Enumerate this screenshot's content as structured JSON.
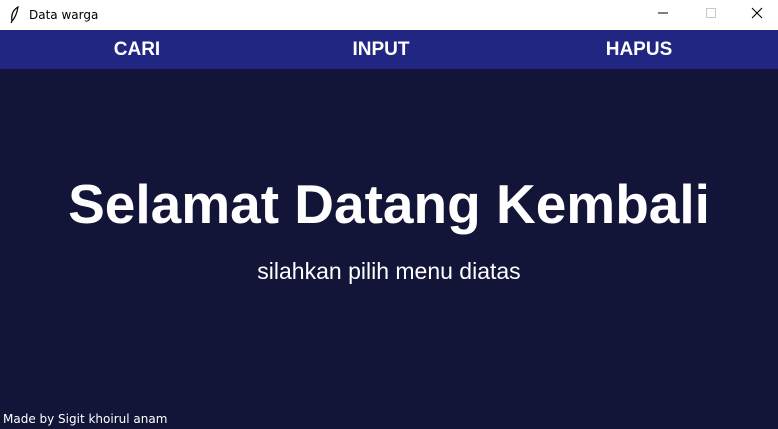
{
  "window": {
    "title": "Data warga",
    "icon": "feather-icon",
    "controls": [
      "minimize-icon",
      "maximize-icon",
      "close-icon"
    ]
  },
  "menu": {
    "items": [
      {
        "label": "CARI"
      },
      {
        "label": "INPUT"
      },
      {
        "label": "HAPUS"
      }
    ]
  },
  "main": {
    "heading": "Selamat Datang Kembali",
    "subtitle": "silahkan pilih menu diatas",
    "credit": "Made by Sigit khoirul anam"
  },
  "colors": {
    "background": "#121438",
    "menubar": "#212682",
    "text": "#ffffff",
    "titlebar": "#ffffff"
  }
}
